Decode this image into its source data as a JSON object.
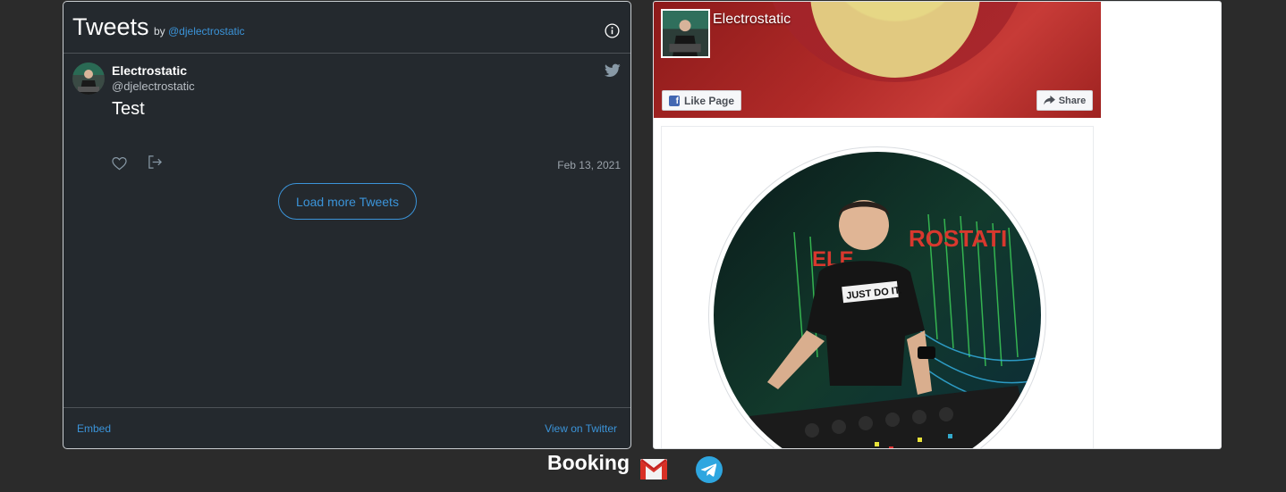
{
  "twitter": {
    "title": "Tweets",
    "by": "by",
    "handle_link": "@djelectrostatic",
    "tweet": {
      "name": "Electrostatic",
      "username": "@djelectrostatic",
      "text": "Test",
      "date": "Feb 13, 2021"
    },
    "load_more": "Load more Tweets",
    "embed": "Embed",
    "view_on_twitter": "View on Twitter",
    "accent": "#3b94d9",
    "background": "#24292e"
  },
  "facebook": {
    "page_name": "Electrostatic",
    "like_page": "Like Page",
    "share": "Share",
    "accent": "#4267b2"
  },
  "booking": {
    "label": "Booking"
  }
}
